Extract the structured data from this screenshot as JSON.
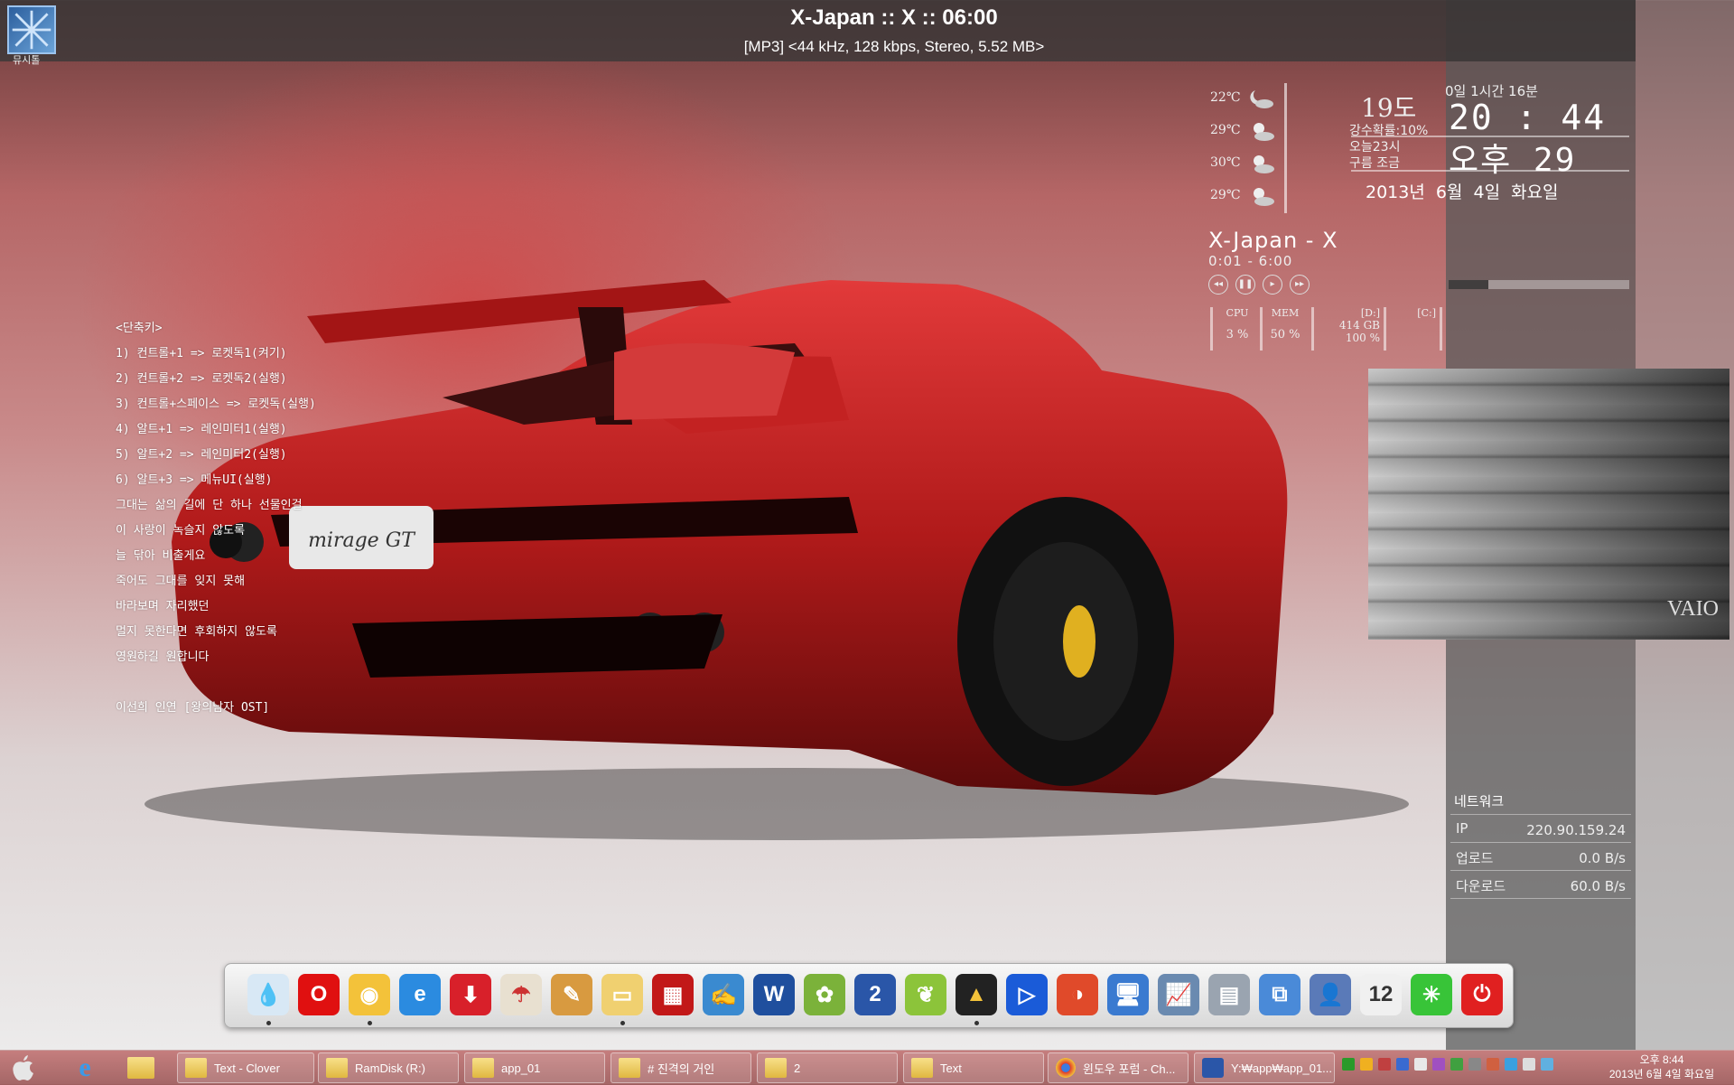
{
  "now_playing_bar": {
    "title": "X-Japan :: X :: 06:00",
    "info": "[MP3] <44 kHz, 128 kbps, Stereo, 5.52 MB>",
    "icon_label": "뮤시톨"
  },
  "notes": [
    "<단축키>",
    "1) 컨트롤+1 => 로켓독1(켜기)",
    "2) 컨트롤+2 => 로켓독2(실행)",
    "3) 컨트롤+스페이스 => 로켓독(실행)",
    "4) 알트+1 => 레인미터1(실행)",
    "5) 알트+2 => 레인미터2(실행)",
    "6) 알트+3 => 메뉴UI(실행)",
    "그대는 삶의 길에 단 하나 선물인걸",
    "이 사랑이 녹슬지 않도록",
    "늘 닦아 비출게요",
    "죽어도 그대를 잊지 못해",
    "바라보며 자리했던",
    "멀지 못한다면 후회하지 않도록",
    "영원하길 원합니다",
    "",
    "이선희 인연 [왕의남자 OST]"
  ],
  "weather": {
    "forecast": [
      {
        "temp": "22℃",
        "icon": "moon-cloud-icon"
      },
      {
        "temp": "29℃",
        "icon": "sun-cloud-icon"
      },
      {
        "temp": "30℃",
        "icon": "sun-cloud-icon"
      },
      {
        "temp": "29℃",
        "icon": "sun-cloud-icon"
      }
    ],
    "current_temp": "19도",
    "rain": "강수확률:10%",
    "forecast_line1": "오늘23시",
    "forecast_line2": "구름 조금"
  },
  "clock": {
    "uptime": "0일 1시간 16분",
    "time": "20 : 44",
    "ampm": "오후 29",
    "date": "2013년 6월 4일 화요일"
  },
  "player": {
    "title": "X-Japan - X",
    "time": "0:01 - 6:00",
    "controls": [
      "◂◂",
      "❚❚",
      "▸",
      "▸▸"
    ],
    "progress": 0.22
  },
  "system": {
    "cpu_label": "CPU",
    "cpu_value": "3 %",
    "mem_label": "MEM",
    "mem_value": "50 %",
    "d_label": "[D:]",
    "d_value": "414 GB",
    "d_pct": "100 %",
    "c_label": "[C:]"
  },
  "photo": {
    "brand": "VAIO"
  },
  "network": {
    "header": "네트워크",
    "ip_label": "IP",
    "ip_value": "220.90.159.24",
    "up_label": "업로드",
    "up_value": "0.0 B/s",
    "down_label": "다운로드",
    "down_value": "60.0 B/s"
  },
  "dock": [
    {
      "name": "water-drop-icon",
      "bg": "#d8e8f5",
      "fg": "#6aa",
      "glyph": "💧"
    },
    {
      "name": "opera-icon",
      "bg": "#e01010",
      "fg": "#fff",
      "glyph": "O"
    },
    {
      "name": "chrome-icon",
      "bg": "#f3c23a",
      "fg": "#fff",
      "glyph": "◉"
    },
    {
      "name": "ie-icon",
      "bg": "#2b8be0",
      "fg": "#fff",
      "glyph": "e"
    },
    {
      "name": "download-icon",
      "bg": "#d8202a",
      "fg": "#fff",
      "glyph": "⬇"
    },
    {
      "name": "umbrella-icon",
      "bg": "#e8e0d0",
      "fg": "#c33",
      "glyph": "☂"
    },
    {
      "name": "tools-icon",
      "bg": "#d89a40",
      "fg": "#fff",
      "glyph": "✎"
    },
    {
      "name": "folder-icon",
      "bg": "#f0d070",
      "fg": "#fff",
      "glyph": "▭"
    },
    {
      "name": "grid-app-icon",
      "bg": "#c21818",
      "fg": "#fff",
      "glyph": "▦"
    },
    {
      "name": "notepad-icon",
      "bg": "#3a8ad0",
      "fg": "#fff",
      "glyph": "✍"
    },
    {
      "name": "word-icon",
      "bg": "#1f4f9e",
      "fg": "#fff",
      "glyph": "W"
    },
    {
      "name": "paint-icon",
      "bg": "#7bb23a",
      "fg": "#fff",
      "glyph": "✿"
    },
    {
      "name": "hangul-icon",
      "bg": "#2a56a8",
      "fg": "#fff",
      "glyph": "2"
    },
    {
      "name": "olive-icon",
      "bg": "#8cc43a",
      "fg": "#fff",
      "glyph": "❦"
    },
    {
      "name": "aimp-icon",
      "bg": "#222",
      "fg": "#f3c23a",
      "glyph": "▲"
    },
    {
      "name": "media-player-icon",
      "bg": "#1a5bd8",
      "fg": "#fff",
      "glyph": "▷"
    },
    {
      "name": "media-red-icon",
      "bg": "#e04a2a",
      "fg": "#fff",
      "glyph": "◑"
    },
    {
      "name": "network-pc-icon",
      "bg": "#3a7ad0",
      "fg": "#fff",
      "glyph": "🖥"
    },
    {
      "name": "monitor-icon",
      "bg": "#6a8ab0",
      "fg": "#fff",
      "glyph": "📈"
    },
    {
      "name": "drive-icon",
      "bg": "#9aa4b0",
      "fg": "#fff",
      "glyph": "▤"
    },
    {
      "name": "registry-icon",
      "bg": "#4a8ad8",
      "fg": "#fff",
      "glyph": "⧉"
    },
    {
      "name": "user-pc-icon",
      "bg": "#5a7ab8",
      "fg": "#fff",
      "glyph": "👤"
    },
    {
      "name": "calendar-icon",
      "bg": "#f0f0f0",
      "fg": "#333",
      "glyph": "12"
    },
    {
      "name": "green-burst-icon",
      "bg": "#38c438",
      "fg": "#fff",
      "glyph": "✳"
    },
    {
      "name": "power-icon",
      "bg": "#e02020",
      "fg": "#fff",
      "glyph": "⏻"
    }
  ],
  "taskbar": {
    "start": "",
    "buttons": [
      {
        "label": "Text - Clover",
        "icon": "clover-icon"
      },
      {
        "label": "RamDisk (R:)",
        "icon": "folder-icon"
      },
      {
        "label": "app_01",
        "icon": "folder-icon"
      },
      {
        "label": "# 진격의 거인",
        "icon": "folder-icon"
      },
      {
        "label": "2",
        "icon": "folder-icon"
      },
      {
        "label": "Text",
        "icon": "folder-icon"
      },
      {
        "label": "윈도우 포럼 - Ch...",
        "icon": "chrome-icon"
      },
      {
        "label": "Y:₩app₩app_01...",
        "icon": "hangul-icon"
      }
    ],
    "clock_time": "오후 8:44",
    "clock_date": "2013년 6월 4일 화요일"
  }
}
